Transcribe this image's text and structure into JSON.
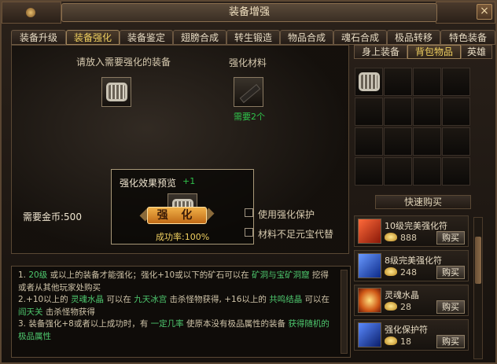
{
  "window": {
    "title": "装备增强"
  },
  "tabs": [
    "装备升级",
    "装备强化",
    "装备鉴定",
    "翅膀合成",
    "转生锻造",
    "物品合成",
    "魂石合成",
    "极品转移",
    "特色装备"
  ],
  "active_tab": 1,
  "right_tabs": [
    "身上装备",
    "背包物品",
    "英雄"
  ],
  "active_right_tab": 1,
  "strengthen": {
    "place_hint": "请放入需要强化的装备",
    "material_label": "强化材料",
    "material_need": "需要2个",
    "preview_title": "强化效果预览",
    "preview_bonus": "+1",
    "success_rate": "成功率:100%",
    "gold_label": "需要金币:500",
    "strengthen_button": "强 化",
    "option_protect": "使用强化保护",
    "option_yuanbao": "材料不足元宝代替"
  },
  "description": {
    "l1a": "1. ",
    "l1b": "20级",
    "l1c": " 或以上的装备才能强化；强化+10或以下的矿石可以在 ",
    "l1d": "矿洞与宝矿洞窟",
    "l1e": " 挖得或者从其他玩家处购买",
    "l2a": "2.+10以上的 ",
    "l2b": "灵魂水晶",
    "l2c": " 可以在 ",
    "l2d": "九天冰宫",
    "l2e": " 击杀怪物获得, +16以上的 ",
    "l2f": "共鸣结晶",
    "l2g": " 可以在 ",
    "l2h": "阎天关",
    "l2i": " 击杀怪物获得",
    "l3a": "3. 装备强化+8或者以上成功时，有 ",
    "l3b": "一定几率",
    "l3c": " 使原本没有极品属性的装备 ",
    "l3d": "获得随机的极品属性"
  },
  "quick_buy": {
    "label": "快速购买"
  },
  "shop_items": [
    {
      "name": "10级完美强化符",
      "price": "888",
      "buy": "购买",
      "color": "#c8301c"
    },
    {
      "name": "8级完美强化符",
      "price": "248",
      "buy": "购买",
      "color": "#2850c8"
    },
    {
      "name": "灵魂水晶",
      "price": "28",
      "buy": "购买",
      "color": "#d05a18"
    },
    {
      "name": "强化保护符",
      "price": "18",
      "buy": "购买",
      "color": "#1a4ab0"
    }
  ]
}
